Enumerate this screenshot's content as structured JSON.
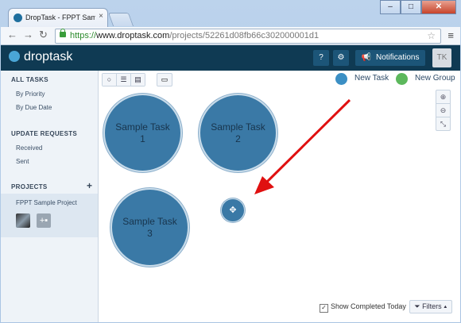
{
  "browser": {
    "tab_title": "DropTask - FPPT Sample P",
    "tab_close": "×",
    "url_scheme": "https://",
    "url_host": "www.droptask.com",
    "url_path": "/projects/52261d08fb66c302000001d1",
    "window_buttons": [
      "–",
      "□",
      "✕"
    ]
  },
  "app": {
    "logo_text": "droptask",
    "help_label": "?",
    "settings_icon": "gear-icon",
    "notifications_label": "Notifications",
    "avatar_initials": "TK"
  },
  "sidebar": {
    "all_tasks_heading": "ALL TASKS",
    "by_priority": "By Priority",
    "by_due_date": "By Due Date",
    "update_requests_heading": "UPDATE REQUESTS",
    "received": "Received",
    "sent": "Sent",
    "projects_heading": "PROJECTS",
    "project_name": "FPPT Sample Project",
    "add_icon": "+"
  },
  "toolbar": {
    "new_task": "New Task",
    "new_group": "New Group",
    "new_task_color": "#3b8fc4",
    "new_group_color": "#5cb85c"
  },
  "tasks": [
    {
      "line1": "Sample Task",
      "line2": "1"
    },
    {
      "line1": "Sample Task",
      "line2": "2"
    },
    {
      "line1": "Sample Task",
      "line2": "3"
    }
  ],
  "footer": {
    "show_completed": "Show Completed Today",
    "show_completed_checked": true,
    "filters": "Filters"
  },
  "colors": {
    "appbar": "#0f3a53",
    "task_fill": "#3a79a6",
    "arrow": "#e01010"
  }
}
